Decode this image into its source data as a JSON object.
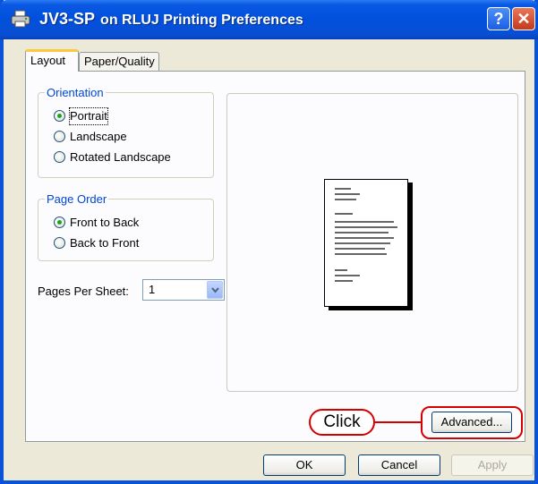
{
  "window": {
    "title_model": "JV3-SP",
    "title_rest": "on RLUJ Printing Preferences",
    "help_glyph": "?",
    "close_glyph": "✕"
  },
  "tabs": [
    {
      "label": "Layout",
      "selected": true
    },
    {
      "label": "Paper/Quality",
      "selected": false
    }
  ],
  "orientation": {
    "label": "Orientation",
    "options": [
      {
        "label": "Portrait",
        "selected": true
      },
      {
        "label": "Landscape",
        "selected": false
      },
      {
        "label": "Rotated Landscape",
        "selected": false
      }
    ]
  },
  "page_order": {
    "label": "Page Order",
    "options": [
      {
        "label": "Front to Back",
        "selected": true
      },
      {
        "label": "Back to Front",
        "selected": false
      }
    ]
  },
  "pages_per_sheet": {
    "label": "Pages Per Sheet:",
    "value": "1"
  },
  "annotation": {
    "click_label": "Click",
    "color": "#d40000"
  },
  "buttons": {
    "advanced": "Advanced...",
    "ok": "OK",
    "cancel": "Cancel",
    "apply": "Apply"
  },
  "colors": {
    "title_bar": "#0050dd",
    "group_label": "#0046d5",
    "active_tab_accent": "#ffc83c"
  }
}
